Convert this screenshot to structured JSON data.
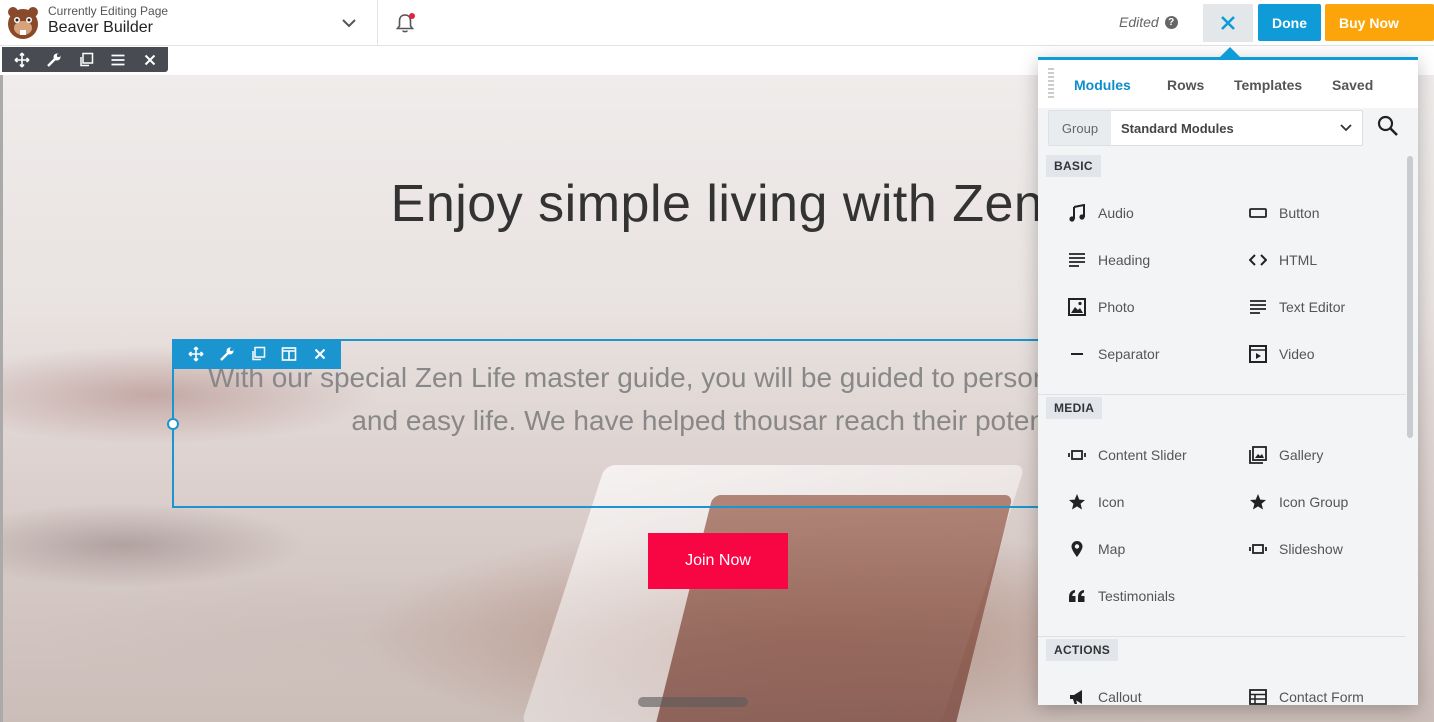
{
  "topbar": {
    "editing_label": "Currently Editing Page",
    "page_title": "Beaver Builder",
    "status": "Edited",
    "help_glyph": "?",
    "done_label": "Done",
    "buy_label": "Buy Now"
  },
  "hero": {
    "title": "Enjoy simple living with Zen",
    "text": "With our special Zen Life master guide, you will be guided to person living a simple and easy life. We have helped thousar reach their potential.",
    "button_label": "Join Now"
  },
  "panel": {
    "tabs": [
      {
        "label": "Modules",
        "active": true
      },
      {
        "label": "Rows",
        "active": false
      },
      {
        "label": "Templates",
        "active": false
      },
      {
        "label": "Saved",
        "active": false
      }
    ],
    "group_label": "Group",
    "group_value": "Standard Modules",
    "sections": [
      {
        "title": "BASIC",
        "items": [
          {
            "label": "Audio",
            "icon": "music-note-icon"
          },
          {
            "label": "Button",
            "icon": "button-icon"
          },
          {
            "label": "Heading",
            "icon": "heading-icon"
          },
          {
            "label": "HTML",
            "icon": "code-icon"
          },
          {
            "label": "Photo",
            "icon": "photo-icon"
          },
          {
            "label": "Text Editor",
            "icon": "text-editor-icon"
          },
          {
            "label": "Separator",
            "icon": "separator-icon"
          },
          {
            "label": "Video",
            "icon": "video-icon"
          }
        ]
      },
      {
        "title": "MEDIA",
        "items": [
          {
            "label": "Content Slider",
            "icon": "slider-icon"
          },
          {
            "label": "Gallery",
            "icon": "gallery-icon"
          },
          {
            "label": "Icon",
            "icon": "star-icon"
          },
          {
            "label": "Icon Group",
            "icon": "star-icon"
          },
          {
            "label": "Map",
            "icon": "map-pin-icon"
          },
          {
            "label": "Slideshow",
            "icon": "slider-icon"
          },
          {
            "label": "Testimonials",
            "icon": "quote-icon"
          }
        ]
      },
      {
        "title": "ACTIONS",
        "items": [
          {
            "label": "Callout",
            "icon": "megaphone-icon"
          },
          {
            "label": "Contact Form",
            "icon": "form-icon"
          }
        ]
      }
    ]
  },
  "colors": {
    "accent": "#0e9bd8",
    "buy": "#fca50a",
    "join": "#f80644"
  }
}
